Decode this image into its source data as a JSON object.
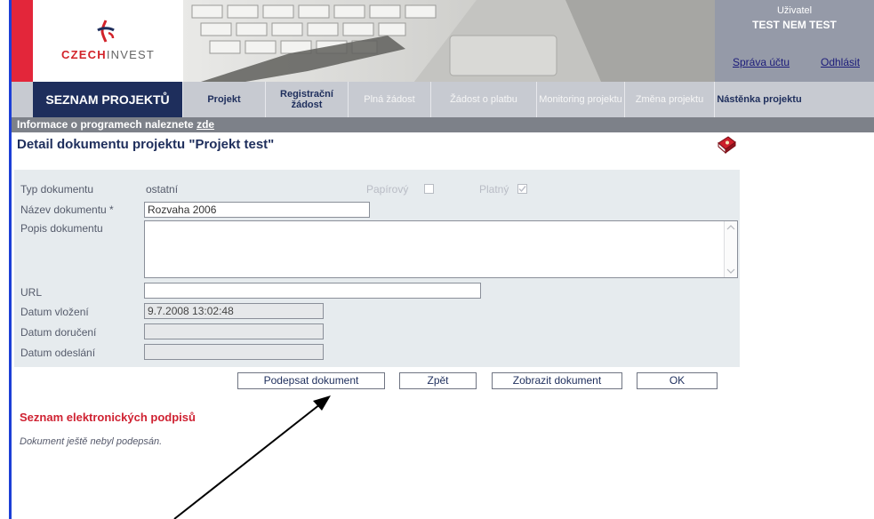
{
  "logo": {
    "text_part1": "CZECH",
    "text_part2": "INVEST",
    "icon": "czechinvest-logo-mark"
  },
  "header": {
    "user_caption": "Uživatel",
    "user_name": "TEST NEM TEST",
    "account_link": "Správa účtu",
    "logout_link": "Odhlásit"
  },
  "nav": {
    "items": [
      {
        "label": "SEZNAM PROJEKTŮ",
        "state": "active"
      },
      {
        "label": "Projekt",
        "state": "enabled"
      },
      {
        "label": "Registrační žádost",
        "state": "enabled"
      },
      {
        "label": "Plná žádost",
        "state": "disabled"
      },
      {
        "label": "Žádost o platbu",
        "state": "disabled"
      },
      {
        "label": "Monitoring projektu",
        "state": "disabled"
      },
      {
        "label": "Změna projektu",
        "state": "disabled"
      },
      {
        "label": "Nástěnka projektu",
        "state": "enabled"
      }
    ]
  },
  "info_bar": {
    "text": "Informace o programech naleznete ",
    "link": "zde"
  },
  "page": {
    "title": "Detail dokumentu projektu  \"Projekt test\"",
    "help_icon": "book-icon"
  },
  "form": {
    "type_label": "Typ dokumentu",
    "type_value": "ostatní",
    "paper_label": "Papírový",
    "paper_checked": false,
    "valid_label": "Platný",
    "valid_checked": true,
    "name_label": "Název dokumentu *",
    "name_value": "Rozvaha 2006",
    "description_label": "Popis dokumentu",
    "description_value": "",
    "url_label": "URL",
    "url_value": "",
    "inserted_label": "Datum vložení",
    "inserted_value": "9.7.2008 13:02:48",
    "delivered_label": "Datum doručení",
    "delivered_value": "",
    "sent_label": "Datum odeslání",
    "sent_value": ""
  },
  "buttons": {
    "sign": "Podepsat dokument",
    "back": "Zpět",
    "show": "Zobrazit dokument",
    "ok": "OK"
  },
  "signatures": {
    "title": "Seznam elektronických podpisů",
    "empty_text": "Dokument ještě nebyl podepsán."
  },
  "colors": {
    "navy": "#1e2e5c",
    "nav_bar": "#c7cad1",
    "info_bar": "#7d8189",
    "brand_red": "#e3263a",
    "form_bg": "#e6ebee",
    "left_rule": "#1c3fd6"
  }
}
